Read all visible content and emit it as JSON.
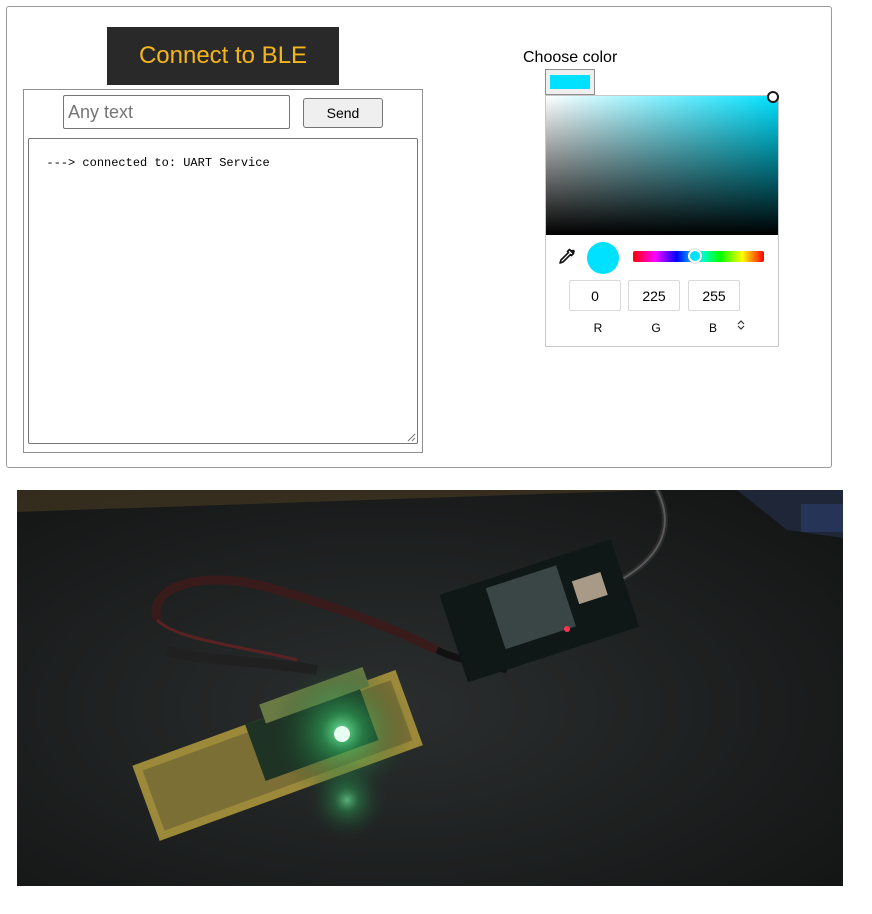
{
  "connect_button": {
    "label": "Connect to BLE"
  },
  "message": {
    "placeholder": "Any text",
    "value": ""
  },
  "send_button": {
    "label": "Send"
  },
  "log": {
    "text": "---> connected to: UART Service"
  },
  "color_picker": {
    "label": "Choose color",
    "selected_color": "#00e1ff",
    "r": "0",
    "g": "225",
    "b": "255",
    "r_label": "R",
    "g_label": "G",
    "b_label": "B",
    "mode_toggle_icon": "up-down-chevron-icon",
    "eyedropper_icon": "eyedropper-icon"
  },
  "photo": {
    "subject_icon": "device-photo"
  },
  "colors": {
    "connect_bg": "#292929",
    "connect_text": "#f5b51b",
    "accent": "#00e1ff"
  }
}
